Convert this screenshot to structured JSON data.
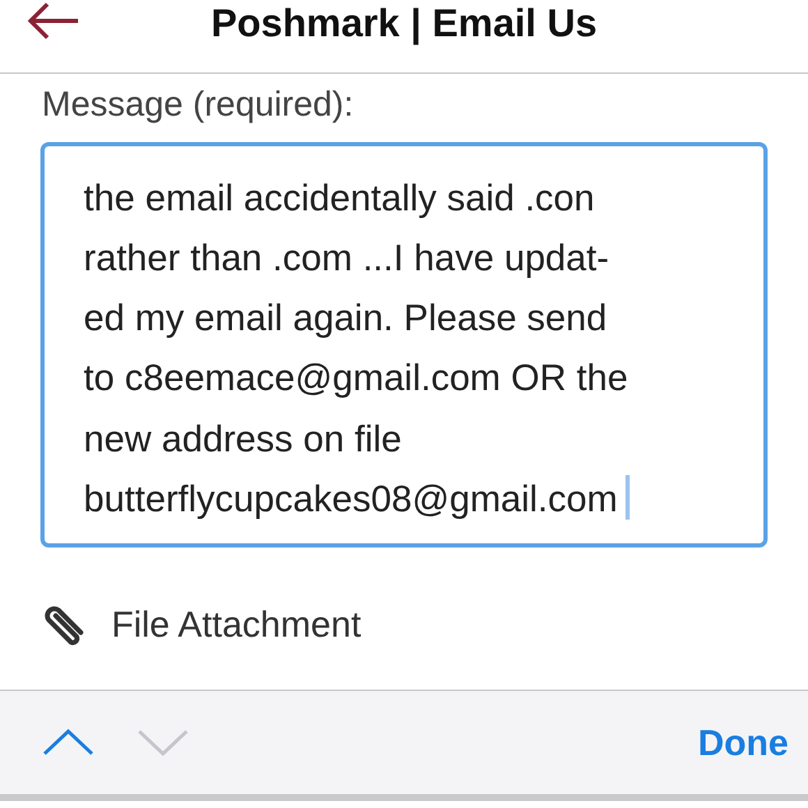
{
  "header": {
    "title": "Poshmark | Email Us"
  },
  "message": {
    "label": "Message (required):",
    "lines": [
      "the email accidentally said .con",
      "rather than .com ...I have updat-",
      "ed my email again. Please send",
      "to c8eemace@gmail.com OR the",
      "new address on file",
      "butterflycupcakes08@gmail.com"
    ],
    "focused": true
  },
  "attachment": {
    "label": "File Attachment"
  },
  "toolbar": {
    "arrows": [
      {
        "kind": "up",
        "disabled": false
      },
      {
        "kind": "down",
        "disabled": true
      }
    ],
    "done": "Done"
  }
}
